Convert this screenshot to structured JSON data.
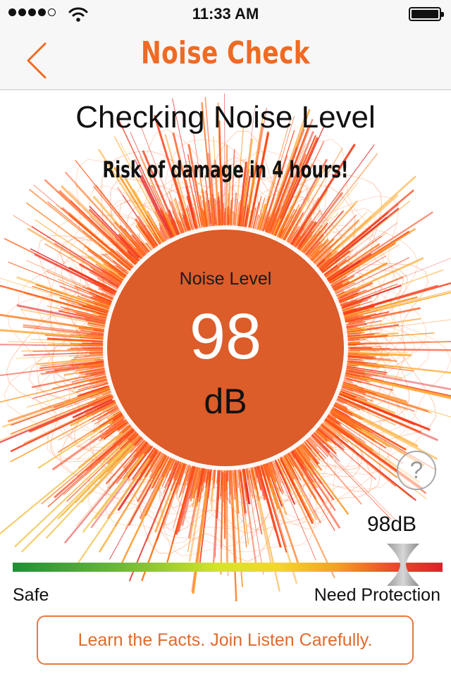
{
  "status_bar": {
    "time": "11:33 AM",
    "signal_bars": 4,
    "signal_total": 5,
    "battery_level": 1.0
  },
  "nav": {
    "title": "Noise Check",
    "back_icon": "chevron-left-icon"
  },
  "page_title": "Checking Noise Level",
  "risk_message": "Risk of damage in 4 hours!",
  "gauge": {
    "label": "Noise Level",
    "value": "98",
    "unit": "dB"
  },
  "help": {
    "icon": "question-icon",
    "label": "?"
  },
  "scale": {
    "reading": "98dB",
    "min_label": "Safe",
    "max_label": "Need Protection",
    "marker_position": 0.92
  },
  "cta": {
    "label": "Learn the Facts. Join Listen Carefully."
  },
  "colors": {
    "accent": "#ef6a22",
    "gauge_fill": "#dc5c2a",
    "button_border": "#e8783c"
  }
}
